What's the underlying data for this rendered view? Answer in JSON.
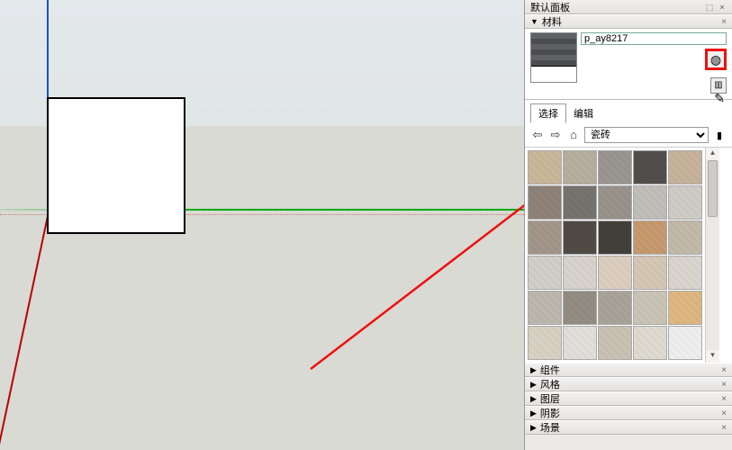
{
  "panel": {
    "title": "默认面板",
    "pin": "⬚",
    "close": "×"
  },
  "sections": {
    "materials": "材料",
    "components": "组件",
    "styles": "风格",
    "layers": "图层",
    "shadows": "阴影",
    "scenes": "场景"
  },
  "material": {
    "name": "p_ay8217",
    "create_icon": "◍",
    "copy_icon": "▥"
  },
  "tabs": {
    "select": "选择",
    "edit": "编辑"
  },
  "toolbar": {
    "back": "⇦",
    "forward": "⇨",
    "home": "⌂",
    "category": "瓷砖",
    "folder": "▮",
    "eyedropper": "✎"
  },
  "grid": {
    "rows": 6,
    "cols": 5,
    "colors": [
      [
        "#c9b89a",
        "#b7af9f",
        "#9a9690",
        "#514f4c",
        "#c6b49c"
      ],
      [
        "#8e8279",
        "#77746e",
        "#9a938b",
        "#c2bfba",
        "#d0cdc6"
      ],
      [
        "#a3978b",
        "#504b45",
        "#433f39",
        "#c79a70",
        "#c3bba8"
      ],
      [
        "#d3cfc9",
        "#d9d4cd",
        "#dccfc0",
        "#d6c8b5",
        "#dbd6ce"
      ],
      [
        "#bdb7ad",
        "#948d83",
        "#aaa39a",
        "#cbc4b8",
        "#dfb880"
      ],
      [
        "#d9d2c4",
        "#e3e0db",
        "#cac2b4",
        "#e0dbd0",
        "#efefef"
      ]
    ]
  },
  "scroll": {
    "up": "▴",
    "down": "▾"
  }
}
